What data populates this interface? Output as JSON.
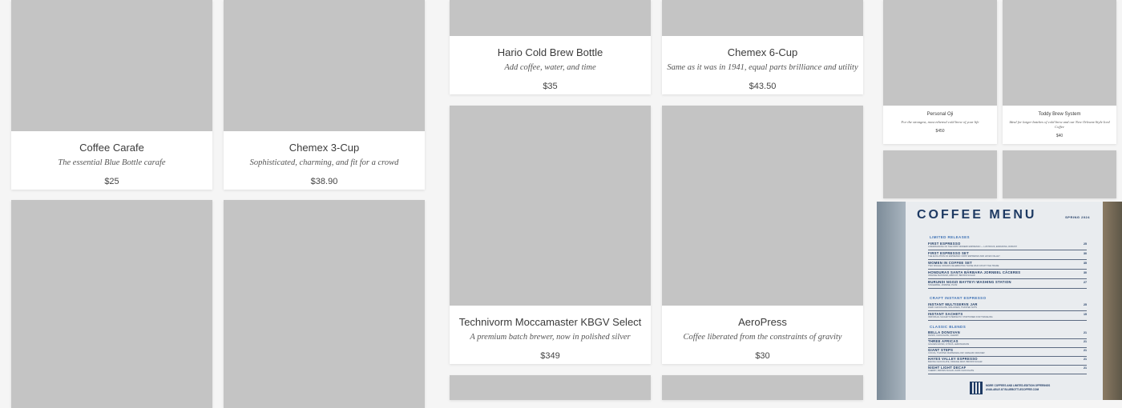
{
  "products": {
    "coffee_carafe": {
      "name": "Coffee Carafe",
      "desc": "The essential Blue Bottle carafe",
      "price": "$25"
    },
    "chemex_3": {
      "name": "Chemex 3-Cup",
      "desc": "Sophisticated, charming, and fit for a crowd",
      "price": "$38.90"
    },
    "hario": {
      "name": "Hario Cold Brew Bottle",
      "desc": "Add coffee, water, and time",
      "price": "$35"
    },
    "chemex_6": {
      "name": "Chemex 6-Cup",
      "desc": "Same as it was in 1941, equal parts brilliance and utility",
      "price": "$43.50"
    },
    "technivorm": {
      "name": "Technivorm Moccamaster KBGV Select",
      "desc": "A premium batch brewer, now in polished silver",
      "price": "$349"
    },
    "aeropress": {
      "name": "AeroPress",
      "desc": "Coffee liberated from the constraints of gravity",
      "price": "$30"
    },
    "oji": {
      "name": "Personal Oji",
      "desc": "For the strongest, most ethereal cold brew of your life",
      "price": "$450"
    },
    "toddy": {
      "name": "Toddy Brew System",
      "desc": "Ideal for larger batches of cold brew and our New Orleans-Style Iced Coffee",
      "price": "$40"
    }
  },
  "menu": {
    "title": "COFFEE MENU",
    "season": "SPRING 2024",
    "sections": {
      "limited": "LIMITED RELEASES",
      "instant": "CRAFT INSTANT ESPRESSO",
      "blends": "CLASSIC BLENDS"
    },
    "items": [
      {
        "name": "FIRST ESPRESSO",
        "sub": "A REIMAGINING OF THE FIRST MODERN ESPRESSO — LUSTROUS, ENDURING, ROBUST",
        "price": "25"
      },
      {
        "name": "FIRST ESPRESSO SET",
        "sub": "THE EVOLUTION OF ESPRESSO: FIRST ESPRESSO AND HAYES VALLEY",
        "price": "30"
      },
      {
        "name": "WOMEN IN COFFEE SET",
        "sub": "TWO SINGLE ORIGINS CELEBRATING THOSE WHO UPLIFT THE TRADE",
        "price": "35"
      },
      {
        "name": "HONDURAS SANTA BÁRBARA JORNEEL CÁCERES",
        "sub": "ORANGE BLOSSOM, APRICOT, BROWN SUGAR",
        "price": "30"
      },
      {
        "name": "BURUNDI NGOZI BAYTEYI WASHING STATION",
        "sub": "TANGERINE, JASMINE, PLUM",
        "price": "27"
      },
      {
        "name": "INSTANT MULTISERVE JAR",
        "sub": "DARK CHOCOLATE, MOLASSES, TOASTED NUTS",
        "price": "25"
      },
      {
        "name": "INSTANT SACHETS",
        "sub": "INDIVIDUAL SACHETS PERFECTLY PORTIONED FOR TRAVELING",
        "price": "15"
      },
      {
        "name": "BELLA DONOVAN",
        "sub": "RAISIN, CHOCOLATE, CHERRY",
        "price": "21"
      },
      {
        "name": "THREE AFRICAS",
        "sub": "GOLDEN RAISIN, CITRUS, LEMONGRASS",
        "price": "21"
      },
      {
        "name": "GIANT STEPS",
        "sub": "COCOA, TOASTED MARSHMALLOW, GRAHAM CRACKER",
        "price": "21"
      },
      {
        "name": "HAYES VALLEY ESPRESSO",
        "sub": "BAKING CHOCOLATE, ORANGE ZEST, BROWN SUGAR",
        "price": "21"
      },
      {
        "name": "NIGHT LIGHT DECAF",
        "sub": "CHERRY, BROWN SUGAR, DARK CHOCOLATE",
        "price": "21"
      }
    ],
    "footer_line1": "MORE COFFEES AND LIMITED-EDITION OFFERINGS",
    "footer_line2": "AVAILABLE AT BLUEBOTTLECOFFEE.COM"
  }
}
